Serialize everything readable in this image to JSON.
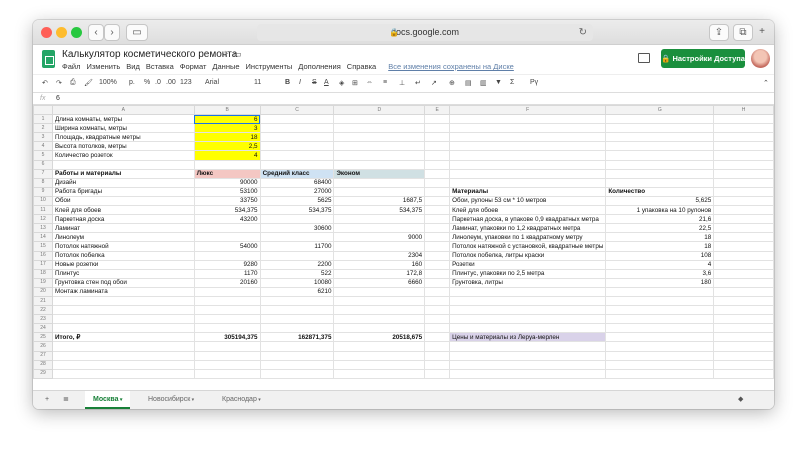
{
  "browser": {
    "url": "docs.google.com",
    "colors": {
      "close": "#ff5f57",
      "minimize": "#febc2e",
      "zoom": "#28c840"
    }
  },
  "doc": {
    "title": "Калькулятор косметического ремонта",
    "menu": [
      "Файл",
      "Изменить",
      "Вид",
      "Вставка",
      "Формат",
      "Данные",
      "Инструменты",
      "Дополнения",
      "Справка"
    ],
    "saved_status": "Все изменения сохранены на Диске",
    "share_label": "Настройки Доступа"
  },
  "toolbar": {
    "zoom": "100%",
    "currency": "р.",
    "percent": "%",
    "dec1": ".0",
    "dec2": ".00",
    "format": "123",
    "font": "Arial",
    "size": "11",
    "bold": "B",
    "italic": "I",
    "strike": "S",
    "color": "A"
  },
  "formula_bar": {
    "label": "fx",
    "value": "6"
  },
  "columns": [
    "",
    "A",
    "B",
    "C",
    "D",
    "E",
    "F",
    "G",
    "H"
  ],
  "rows": [
    [
      "Длина комнаты, метры",
      "6",
      "",
      "",
      "",
      "",
      "",
      ""
    ],
    [
      "Ширина комнаты, метры",
      "3",
      "",
      "",
      "",
      "",
      "",
      ""
    ],
    [
      "Площадь, квадратные метры",
      "18",
      "",
      "",
      "",
      "",
      "",
      ""
    ],
    [
      "Высота потолков, метры",
      "2,5",
      "",
      "",
      "",
      "",
      "",
      ""
    ],
    [
      "Количество розеток",
      "4",
      "",
      "",
      "",
      "",
      "",
      ""
    ],
    [
      "",
      "",
      "",
      "",
      "",
      "",
      "",
      ""
    ],
    [
      "Работы и материалы",
      "Люкс",
      "Средний класс",
      "Эконом",
      "",
      "",
      "",
      ""
    ],
    [
      "Дизайн",
      "90000",
      "68400",
      "",
      "",
      "",
      "",
      ""
    ],
    [
      "Работа бригады",
      "53100",
      "27000",
      "",
      "",
      "Материалы",
      "Количество",
      ""
    ],
    [
      "Обои",
      "33750",
      "5625",
      "1687,5",
      "",
      "Обои, рулоны 53 см * 10 метров",
      "5,625",
      ""
    ],
    [
      "Клей для обоев",
      "534,375",
      "534,375",
      "534,375",
      "",
      "Клей для обоев",
      "1 упаковка на 10 рулонов",
      ""
    ],
    [
      "Паркетная доска",
      "43200",
      "",
      "",
      "",
      "Паркетная доска, в упакове 0,9 квадратных метра",
      "21,6",
      ""
    ],
    [
      "Ламинат",
      "",
      "30600",
      "",
      "",
      "Ламинат, упаковки по 1,2 квадратных метра",
      "22,5",
      ""
    ],
    [
      "Линолеум",
      "",
      "",
      "9000",
      "",
      "Линолеум, упаковки по 1 квадратному метру",
      "18",
      ""
    ],
    [
      "Потолок натяжной",
      "54000",
      "11700",
      "",
      "",
      "Потолок натяжной с установкой, квадратные метры",
      "18",
      ""
    ],
    [
      "Потолок побелка",
      "",
      "",
      "2304",
      "",
      "Потолок побелка, литры краски",
      "108",
      ""
    ],
    [
      "Новые розетки",
      "9280",
      "2200",
      "160",
      "",
      "Розетки",
      "4",
      ""
    ],
    [
      "Плинтус",
      "1170",
      "522",
      "172,8",
      "",
      "Плинтус, упаковки по 2,5 метра",
      "3,6",
      ""
    ],
    [
      "Грунтовка стен под обои",
      "20160",
      "10080",
      "6660",
      "",
      "Грунтовка, литры",
      "180",
      ""
    ],
    [
      "Монтаж ламината",
      "",
      "6210",
      "",
      "",
      "",
      "",
      ""
    ],
    [
      "",
      "",
      "",
      "",
      "",
      "",
      "",
      ""
    ],
    [
      "",
      "",
      "",
      "",
      "",
      "",
      "",
      ""
    ],
    [
      "",
      "",
      "",
      "",
      "",
      "",
      "",
      ""
    ],
    [
      "",
      "",
      "",
      "",
      "",
      "",
      "",
      ""
    ],
    [
      "Итого, ₽",
      "305194,375",
      "162871,375",
      "20518,675",
      "",
      "Цены и материалы из Леруа-мерлен",
      "",
      ""
    ],
    [
      "",
      "",
      "",
      "",
      "",
      "",
      "",
      ""
    ],
    [
      "",
      "",
      "",
      "",
      "",
      "",
      "",
      ""
    ],
    [
      "",
      "",
      "",
      "",
      "",
      "",
      "",
      ""
    ],
    [
      "",
      "",
      "",
      "",
      "",
      "",
      "",
      ""
    ]
  ],
  "sheets": [
    "Москва",
    "Новосибирск",
    "Краснодар"
  ],
  "active_sheet": 0
}
